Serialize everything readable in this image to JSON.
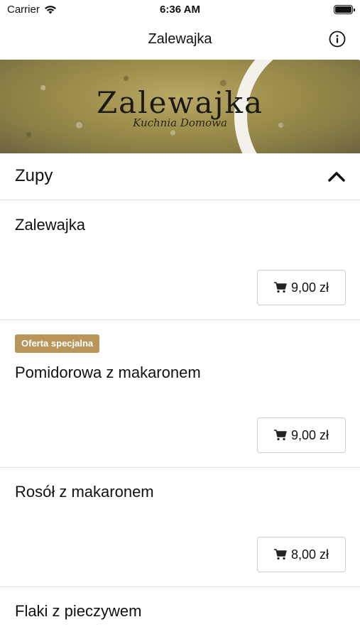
{
  "status_bar": {
    "carrier": "Carrier",
    "time": "6:36 AM"
  },
  "nav": {
    "title": "Zalewajka",
    "info_icon": "info-icon"
  },
  "hero": {
    "title": "Zalewajka",
    "subtitle": "Kuchnia Domowa"
  },
  "section": {
    "title": "Zupy",
    "expanded": true,
    "icon": "chevron-up-icon"
  },
  "items": [
    {
      "name": "Zalewajka",
      "price": "9,00 zł"
    },
    {
      "name": "Pomidorowa z makaronem",
      "price": "9,00 zł",
      "badge": "Oferta specjalna"
    },
    {
      "name": "Rosół z makaronem",
      "price": "8,00 zł"
    },
    {
      "name": "Flaki z pieczywem"
    }
  ],
  "colors": {
    "badge": "#b8955a",
    "divider": "#e2e2e2"
  }
}
